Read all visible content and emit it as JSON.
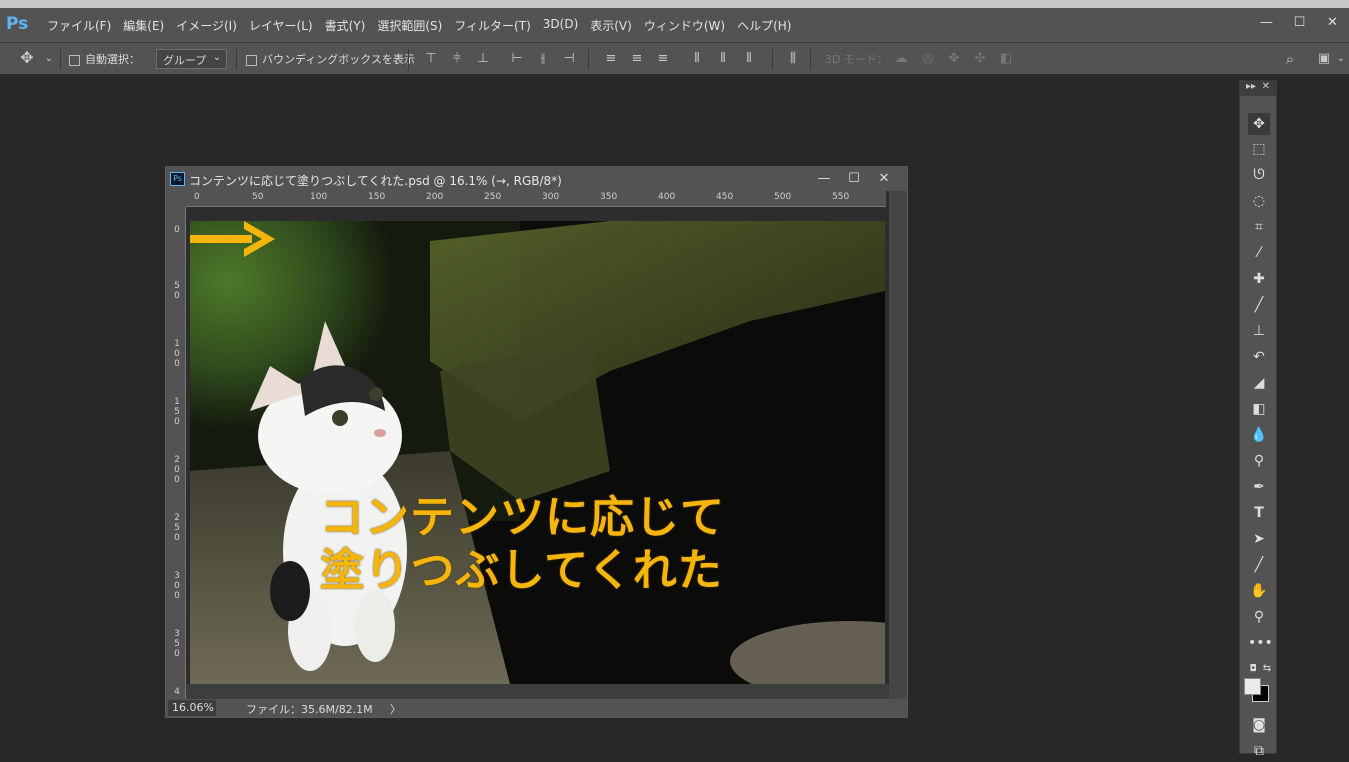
{
  "app": {
    "logo": "Ps"
  },
  "menu": [
    "ファイル(F)",
    "編集(E)",
    "イメージ(I)",
    "レイヤー(L)",
    "書式(Y)",
    "選択範囲(S)",
    "フィルター(T)",
    "3D(D)",
    "表示(V)",
    "ウィンドウ(W)",
    "ヘルプ(H)"
  ],
  "window_controls": {
    "minimize": "—",
    "maximize": "☐",
    "close": "✕"
  },
  "options": {
    "auto_select_label": "自動選択：",
    "auto_select_value": "グループ",
    "bounding_box_label": "バウンディングボックスを表示",
    "mode_3d_label": "3D モード："
  },
  "document": {
    "badge": "Ps",
    "title": "コンテンツに応じて塗りつぶしてくれた.psd @ 16.1% (→, RGB/8*)",
    "ruler_h": [
      "0",
      "50",
      "100",
      "150",
      "200",
      "250",
      "300",
      "350",
      "400",
      "450",
      "500",
      "550"
    ],
    "ruler_v": [
      "0",
      "50",
      "100",
      "150",
      "200",
      "250",
      "300",
      "350",
      "4"
    ],
    "caption_line1": "コンテンツに応じて",
    "caption_line2": "塗りつぶしてくれた",
    "zoom": "16.06%",
    "file_info": "ファイル：35.6M/82.1M",
    "status_arrow": "〉"
  },
  "toolpanel": {
    "header_left": "▸▸",
    "header_right": "✕"
  },
  "colors": {
    "caption": "#f5b50a",
    "ps_blue": "#5fb6f5"
  }
}
